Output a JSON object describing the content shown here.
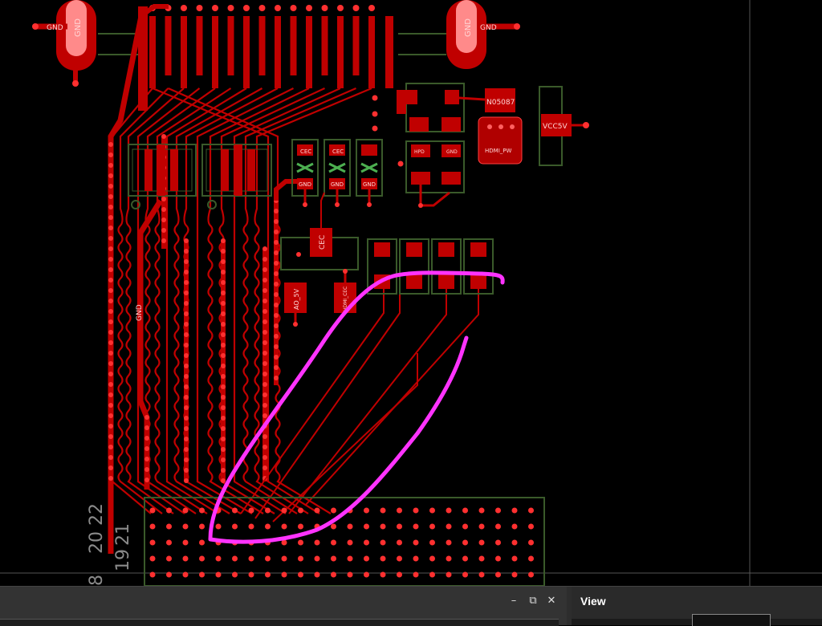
{
  "canvas": {
    "labels": {
      "gnd_left_pad": "GND",
      "gnd_left_trace": "GND",
      "gnd_right_pad": "GND",
      "gnd_right_trace": "GND",
      "n05087": "N05087",
      "vcc5v": "VCC5V",
      "hdmi_pw": "HDMI_PW",
      "cec_small_1": "CEC",
      "cec_small_2": "CEC",
      "gnd_small_1": "GND",
      "gnd_small_2": "GND",
      "gnd_small_3": "GND",
      "hpd": "HPD",
      "gnd_small_4": "GND",
      "cec_vertical": "CEC",
      "ao_5v": "AO_5V",
      "hdmi_cec": "HDMI_CEC",
      "gnd_vertical": "GND",
      "row_20": "20",
      "row_22": "22",
      "row_19": "19",
      "row_21": "21",
      "row_8": "8"
    },
    "annotation_color": "#ff33ff",
    "copper_color": "#cc0000",
    "silkscreen_color": "#3a5a2a"
  },
  "panels": {
    "left": {
      "minimize_glyph": "–",
      "restore_glyph": "⧉",
      "close_glyph": "✕"
    },
    "right": {
      "title": "View"
    }
  }
}
